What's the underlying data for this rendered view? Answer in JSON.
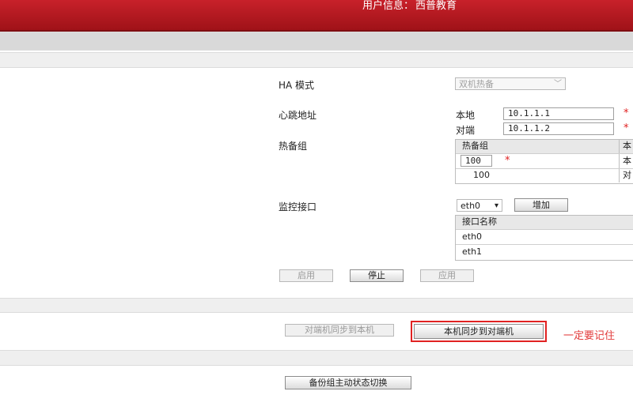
{
  "header": {
    "user_label": "用户信息：",
    "user_name": "西普教育"
  },
  "ha": {
    "mode_label": "HA 模式",
    "mode_value": "双机热备",
    "heartbeat_label": "心跳地址",
    "local_label": "本地",
    "local_ip": "10.1.1.1",
    "peer_label": "对端",
    "peer_ip": "10.1.1.2",
    "group_label": "热备组",
    "group_table": {
      "header_col1": "热备组",
      "header_col2": "本",
      "input_value": "100",
      "input_col2": "本",
      "row_col1": "100",
      "row_col2": "对"
    },
    "monitor_label": "监控接口",
    "interface_select": "eth0",
    "add_button": "增加",
    "interface_table": {
      "header": "接口名称",
      "rows": [
        "eth0",
        "eth1"
      ]
    },
    "buttons": {
      "enable": "启用",
      "stop": "停止",
      "apply": "应用"
    }
  },
  "sync": {
    "peer_to_local": "对端机同步到本机",
    "local_to_peer": "本机同步到对端机",
    "note": "一定要记住"
  },
  "backup": {
    "switch_button": "备份组主动状态切换"
  },
  "colors": {
    "header_red": "#b0161d",
    "required_star": "#e02020",
    "highlight_box": "#e12222"
  }
}
